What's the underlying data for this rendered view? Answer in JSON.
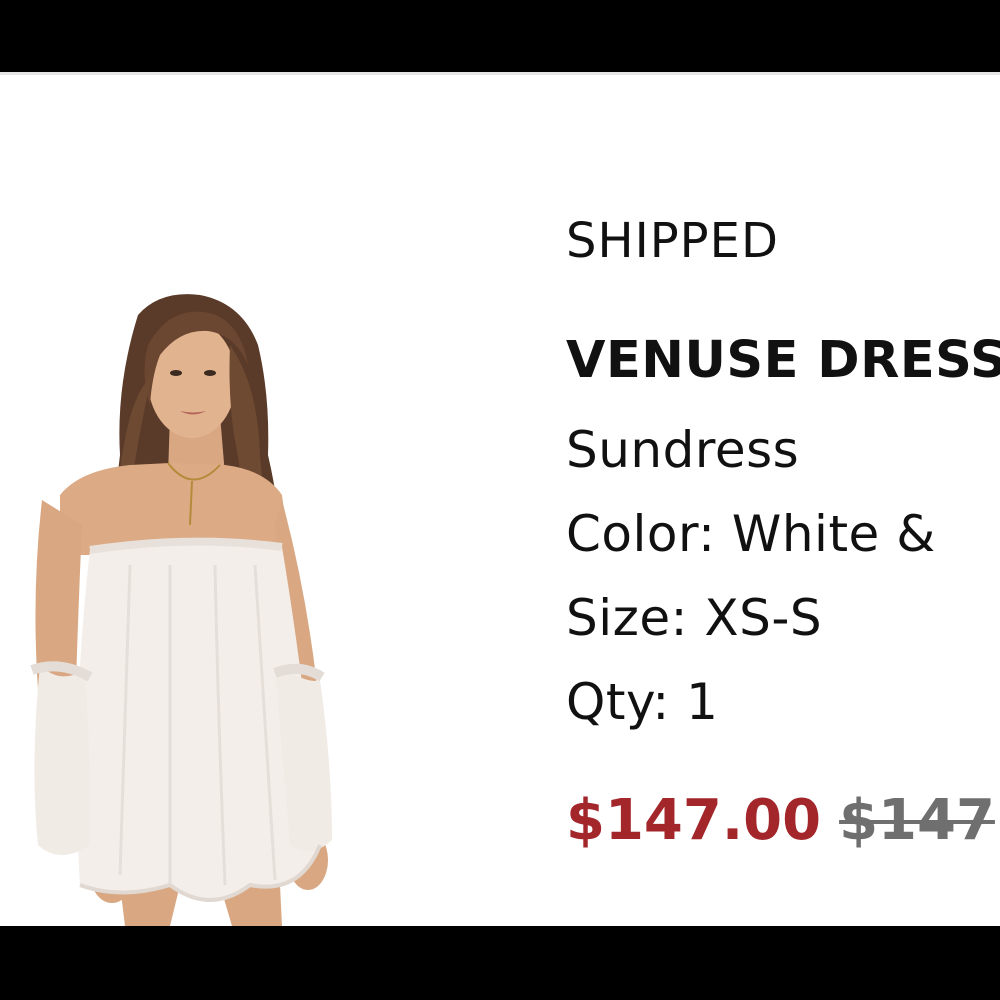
{
  "order_item": {
    "status": "SHIPPED",
    "product_name": "VENUSE DRESS",
    "category": "Sundress",
    "color_label": "Color:",
    "color_value": "White &",
    "size_label": "Size:",
    "size_value": "XS-S",
    "qty_label": "Qty:",
    "qty_value": "1",
    "sale_price": "$147.00",
    "original_price": "$147"
  },
  "colors": {
    "sale_price": "#a3262b",
    "original_price": "#6f6f6f",
    "bars": "#000000"
  },
  "image": {
    "icon": "product-photo"
  }
}
